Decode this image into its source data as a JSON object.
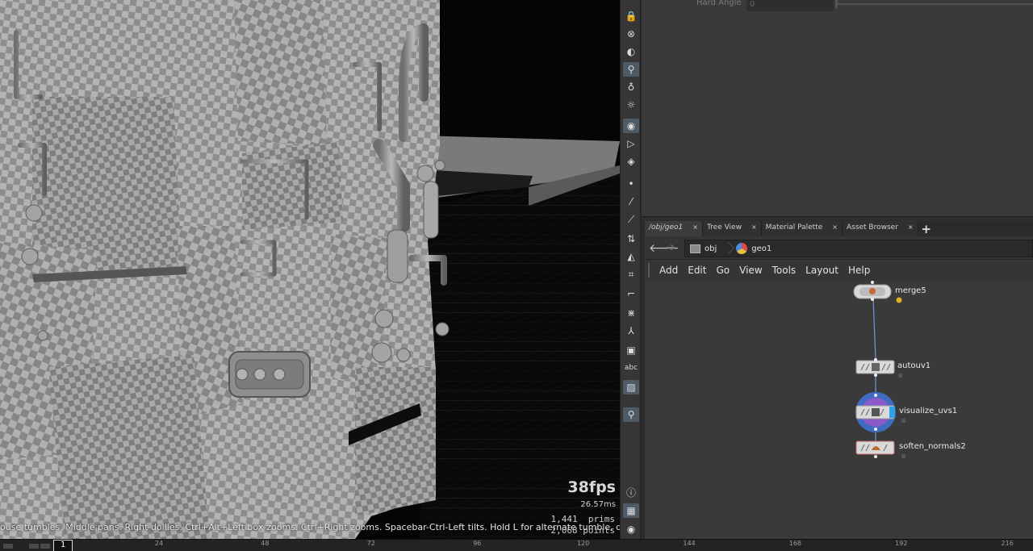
{
  "viewport": {
    "fps": "38fps",
    "ms": "26.57ms",
    "prims": "1,441  prims",
    "points": "2,068 points",
    "hint": "ouse tumbles. Middle pans. Right dollies. Ctrl+Alt+Left box-zooms. Ctrl+Right zooms. Spacebar-Ctrl-Left tilts. Hold L for alternate tumble, dolly, and zoom."
  },
  "toolbar": {
    "items": [
      {
        "icon": "lock-icon",
        "glyph": "🔒"
      },
      {
        "icon": "ghost-icon",
        "glyph": "⊗"
      },
      {
        "icon": "sphere-icon",
        "glyph": "◐"
      },
      {
        "icon": "light-icon",
        "glyph": "⚲",
        "active": true
      },
      {
        "icon": "bulb-icon",
        "glyph": "♁"
      },
      {
        "icon": "camera-light-icon",
        "glyph": "☼"
      },
      {
        "icon": "shading-icon",
        "glyph": "◉",
        "active": true
      },
      {
        "icon": "background-icon",
        "glyph": "▷"
      },
      {
        "icon": "display-options-icon",
        "glyph": "◈"
      },
      {
        "icon": "point-icon",
        "glyph": "•"
      },
      {
        "icon": "brush-icon",
        "glyph": "⁄"
      },
      {
        "icon": "pick-icon",
        "glyph": "⟋"
      },
      {
        "icon": "snap-12-icon",
        "glyph": "⇅"
      },
      {
        "icon": "normal-icon",
        "glyph": "◭"
      },
      {
        "icon": "grid-icon",
        "glyph": "⌗"
      },
      {
        "icon": "corner-icon",
        "glyph": "⌐"
      },
      {
        "icon": "transform-icon",
        "glyph": "⋇"
      },
      {
        "icon": "branch-icon",
        "glyph": "⅄"
      },
      {
        "icon": "stop-icon",
        "glyph": "▣"
      },
      {
        "icon": "text-label-icon",
        "glyph": "abc"
      },
      {
        "icon": "image-icon",
        "glyph": "▨",
        "active": true
      },
      {
        "icon": "pin-icon",
        "glyph": "⚲",
        "active": true
      },
      {
        "icon": "info-icon",
        "glyph": "ⓘ"
      },
      {
        "icon": "quad-view-icon",
        "glyph": "▦",
        "active": true
      },
      {
        "icon": "eye-icon",
        "glyph": "◉"
      }
    ]
  },
  "params": {
    "label": "Hard Angle",
    "value": "0"
  },
  "tabs": [
    {
      "label": "/obj/geo1",
      "active": true
    },
    {
      "label": "Tree View"
    },
    {
      "label": "Material Palette"
    },
    {
      "label": "Asset Browser"
    }
  ],
  "tab_close": "×",
  "tab_add": "+",
  "path": {
    "back": "🡐",
    "forward": "➔",
    "crumbs": [
      "obj",
      "geo1"
    ]
  },
  "menu": [
    "Add",
    "Edit",
    "Go",
    "View",
    "Tools",
    "Layout",
    "Help"
  ],
  "nodes": [
    {
      "name": "merge5"
    },
    {
      "name": "autouv1"
    },
    {
      "name": "visualize_uvs1"
    },
    {
      "name": "soften_normals2"
    }
  ],
  "timeline": {
    "current": "1",
    "ticks": [
      "24",
      "48",
      "72",
      "96",
      "120",
      "144",
      "168",
      "192",
      "216"
    ]
  }
}
